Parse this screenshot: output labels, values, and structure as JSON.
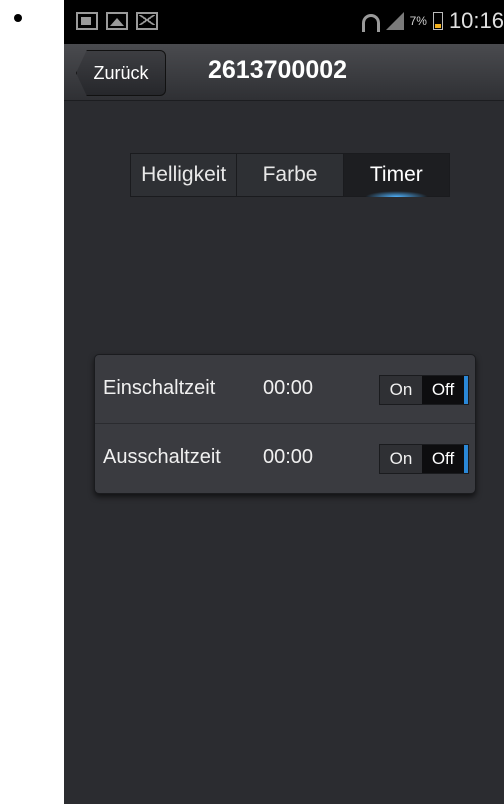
{
  "statusbar": {
    "battery_percent": "7%",
    "time": "10:16"
  },
  "header": {
    "back_label": "Zurück",
    "title": "2613700002"
  },
  "tabs": [
    {
      "label": "Helligkeit",
      "active": false
    },
    {
      "label": "Farbe",
      "active": false
    },
    {
      "label": "Timer",
      "active": true
    }
  ],
  "timer": {
    "rows": [
      {
        "label": "Einschaltzeit",
        "time": "00:00",
        "on_label": "On",
        "off_label": "Off",
        "selected": "Off"
      },
      {
        "label": "Ausschaltzeit",
        "time": "00:00",
        "on_label": "On",
        "off_label": "Off",
        "selected": "Off"
      }
    ]
  },
  "colors": {
    "background": "#2b2c30",
    "accent": "#2a88d8"
  }
}
